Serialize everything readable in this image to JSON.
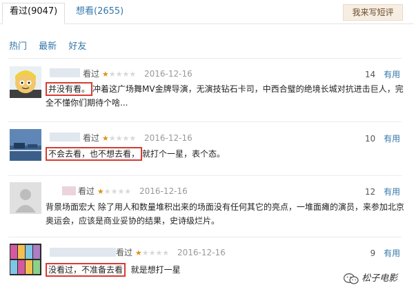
{
  "tabs": {
    "seen": "看过(9047)",
    "want": "想看(2655)",
    "write_button": "我来写短评"
  },
  "subtabs": [
    "热门",
    "最新",
    "好友"
  ],
  "reviews": [
    {
      "verb": "看过",
      "rating_stars": 1,
      "date": "2016-12-16",
      "votes": "14",
      "useful": "有用",
      "highlight": "并没有看。",
      "text": "冲着这广场舞MV金牌导演，无演技钻石卡司，中西合璧的绝境长城对抗进击巨人，完全不懂你们期待个啥..."
    },
    {
      "verb": "看过",
      "rating_stars": 1,
      "date": "2016-12-16",
      "votes": "10",
      "useful": "有用",
      "highlight": "不会去看，也不想去看，",
      "text": "就打个一星，表个态。"
    },
    {
      "verb": "看过",
      "rating_stars": 1,
      "date": "2016-12-16",
      "votes": "12",
      "useful": "有用",
      "highlight": "",
      "text": "背景场面宏大 除了用人和数量堆积出来的场面没有任何其它的亮点，一堆面瘫的演员，来参加北京奥运会，应该是商业妥协的结果，史诗级烂片。"
    },
    {
      "verb": "看过",
      "rating_stars": 1,
      "date": "2016-12-16",
      "votes": "9",
      "useful": "有用",
      "highlight": "没看过，不准备去看",
      "text": "就是想打一星"
    }
  ],
  "watermark": "松子电影",
  "colors": {
    "link": "#3377aa",
    "star": "#e09015",
    "highlight_border": "#d63a32"
  }
}
